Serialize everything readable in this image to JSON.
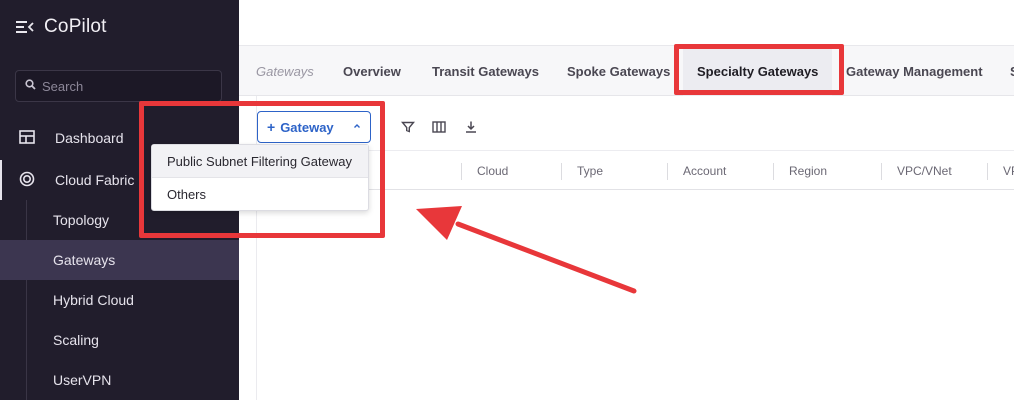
{
  "sidebar": {
    "app_title": "CoPilot",
    "search_placeholder": "Search",
    "items": [
      {
        "label": "Dashboard",
        "icon": "dashboard-icon"
      },
      {
        "label": "Cloud Fabric",
        "icon": "target-icon"
      }
    ],
    "sub_items": [
      {
        "label": "Topology"
      },
      {
        "label": "Gateways",
        "active": true
      },
      {
        "label": "Hybrid Cloud"
      },
      {
        "label": "Scaling"
      },
      {
        "label": "UserVPN"
      }
    ]
  },
  "tabs": {
    "breadcrumb": "Gateways",
    "items": [
      {
        "label": "Overview"
      },
      {
        "label": "Transit Gateways"
      },
      {
        "label": "Spoke Gateways"
      },
      {
        "label": "Specialty Gateways",
        "selected": true
      },
      {
        "label": "Gateway Management"
      },
      {
        "label": "S"
      }
    ]
  },
  "toolbar": {
    "add_label": "Gateway",
    "icons": [
      "filter-icon",
      "columns-icon",
      "download-icon"
    ]
  },
  "table": {
    "columns": [
      "Cloud",
      "Type",
      "Account",
      "Region",
      "VPC/VNet",
      "VP"
    ]
  },
  "dropdown": {
    "options": [
      "Public Subnet Filtering Gateway",
      "Others"
    ]
  },
  "colors": {
    "sidebar_bg": "#211d2c",
    "accent_blue": "#2d63c8",
    "annotation_red": "#e8373a"
  }
}
